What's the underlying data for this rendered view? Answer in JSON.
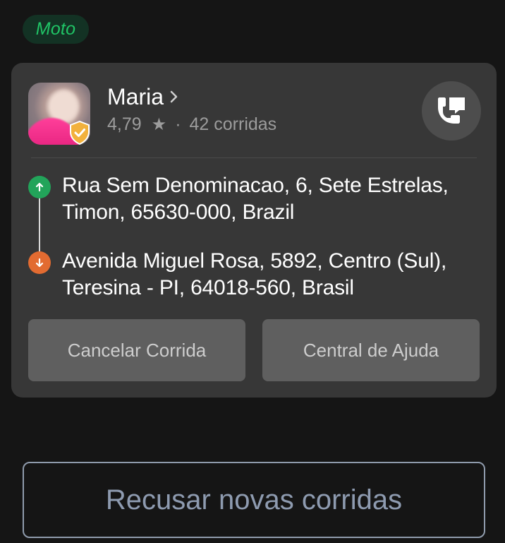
{
  "category": {
    "label": "Moto",
    "color": "#20c466"
  },
  "passenger": {
    "name": "Maria",
    "rating": "4,79",
    "separator": "·",
    "rides": "42 corridas",
    "verified_icon": "shield-check-icon"
  },
  "route": {
    "origin": "Rua Sem Denominacao, 6, Sete Estrelas, Timon, 65630-000, Brazil",
    "destination": "Avenida Miguel Rosa, 5892, Centro (Sul), Teresina - PI, 64018-560, Brasil",
    "origin_color": "#22a45a",
    "destination_color": "#e26b31"
  },
  "actions": {
    "cancel_label": "Cancelar Corrida",
    "help_label": "Central de Ajuda"
  },
  "refuse": {
    "label": "Recusar novas corridas"
  }
}
